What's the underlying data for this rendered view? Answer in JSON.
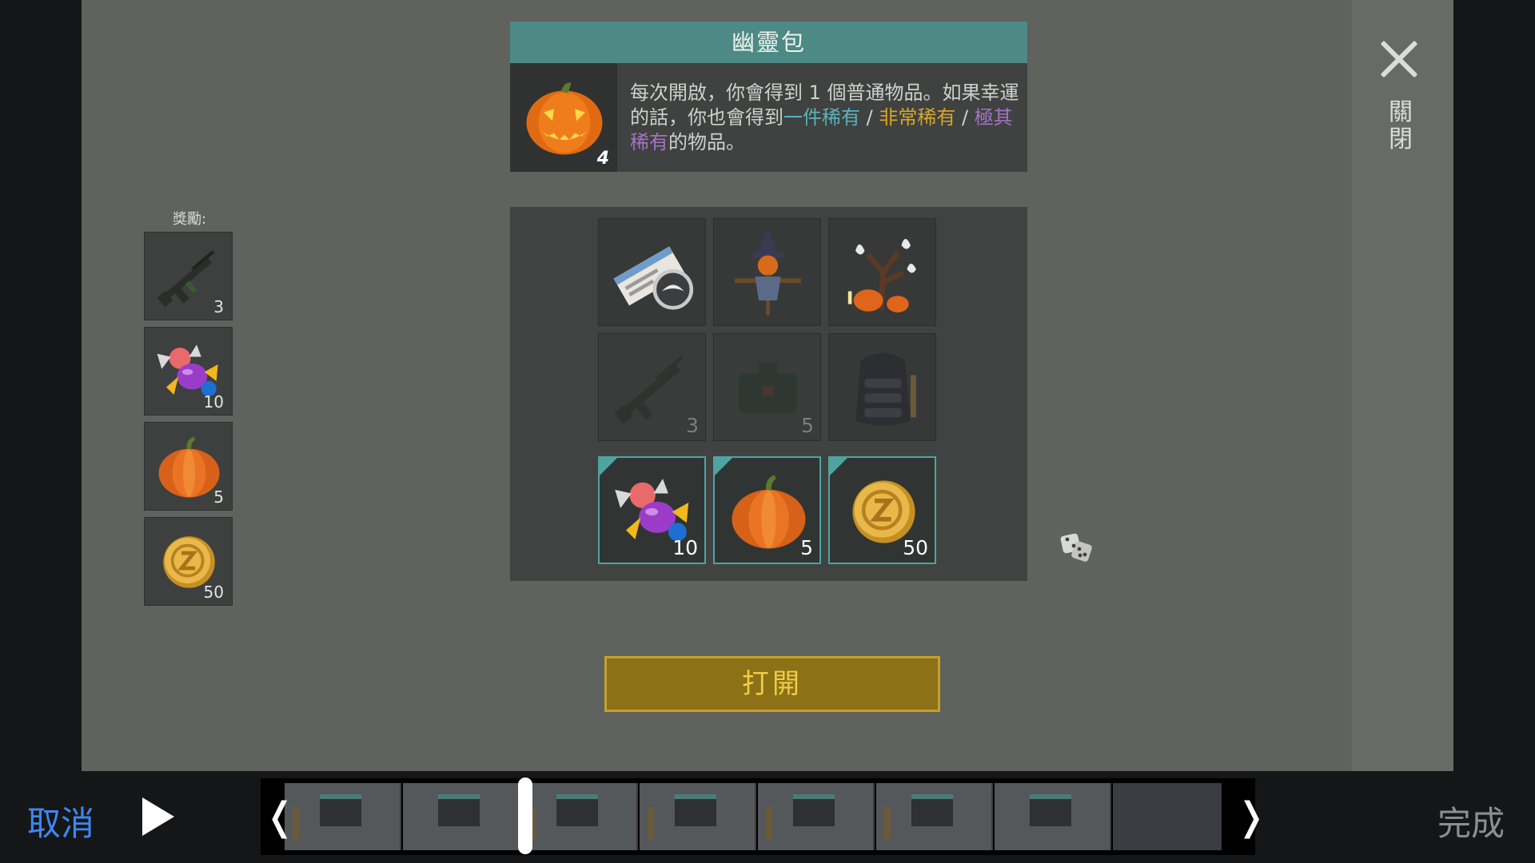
{
  "dialog": {
    "title": "幽靈包",
    "pack_count": "4",
    "description": {
      "part1": "每次開啟，你會得到 1 個普通物品。如果幸運的話，你也會得到",
      "rare": "一件稀有",
      "sep1": " / ",
      "very_rare": "非常稀有",
      "sep2": " / ",
      "epic": "極其稀有",
      "part2": "的物品。"
    },
    "close_label": "關閉",
    "open_button": "打開",
    "colors": {
      "rare": "#59b3be",
      "very_rare": "#d8a52a",
      "epic": "#a572c6",
      "title_bar": "#4d8985"
    }
  },
  "rewards": {
    "label": "獎勵:",
    "items": [
      {
        "icon": "rifle-icon",
        "qty": "3"
      },
      {
        "icon": "candy-icon",
        "qty": "10"
      },
      {
        "icon": "pumpkin-icon",
        "qty": "5"
      },
      {
        "icon": "coin-icon",
        "qty": "50"
      }
    ]
  },
  "grid": {
    "row1": [
      {
        "icon": "newspaper-skin-icon",
        "qty": ""
      },
      {
        "icon": "scarecrow-icon",
        "qty": ""
      },
      {
        "icon": "spooky-tree-icon",
        "qty": ""
      }
    ],
    "row2": [
      {
        "icon": "rifle-icon",
        "qty": "3",
        "state": "locked"
      },
      {
        "icon": "bag-icon",
        "qty": "5",
        "state": "locked"
      },
      {
        "icon": "backpack-icon",
        "qty": ""
      }
    ],
    "row3": [
      {
        "icon": "candy-icon",
        "qty": "10",
        "state": "reward"
      },
      {
        "icon": "pumpkin-icon",
        "qty": "5",
        "state": "reward"
      },
      {
        "icon": "coin-icon",
        "qty": "50",
        "state": "reward"
      }
    ]
  },
  "editor": {
    "cancel": "取消",
    "done": "完成",
    "left_handle": "❬",
    "right_handle": "❭"
  }
}
